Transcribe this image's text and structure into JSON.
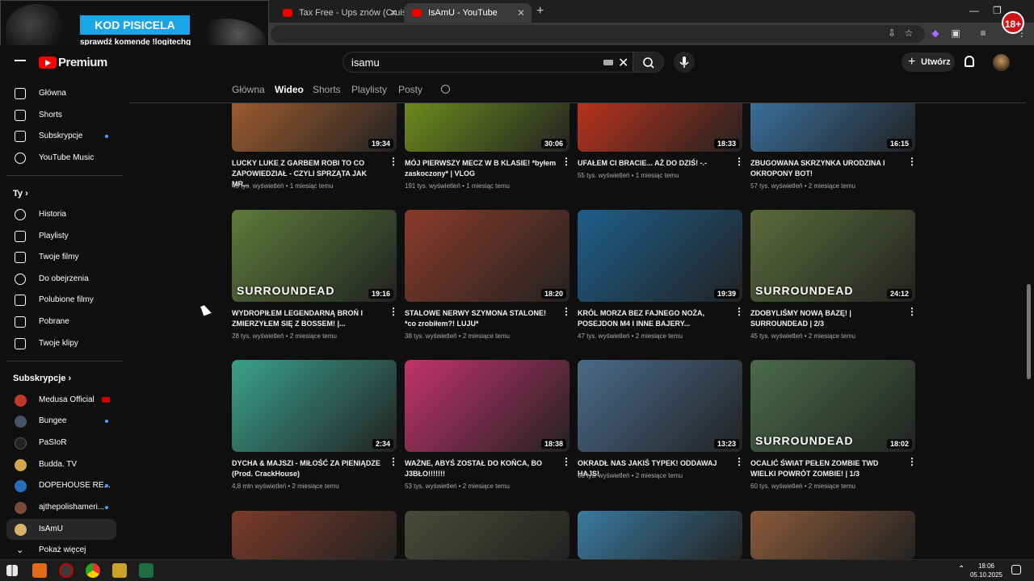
{
  "browser": {
    "tabs": [
      {
        "title": "Tax Free - Ups znów (Cruisy"
      },
      {
        "title": "IsAmU - YouTube"
      }
    ]
  },
  "overlay": {
    "headline": "KOD PISICELA",
    "subline": "sprawdź komendę !logitechg"
  },
  "badge": "18+",
  "header": {
    "logo_text": "Premium",
    "search_value": "isamu",
    "create_label": "Utwórz"
  },
  "channel_tabs": [
    "Główna",
    "Wideo",
    "Shorts",
    "Playlisty",
    "Posty"
  ],
  "sidebar": {
    "main": [
      {
        "label": "Główna",
        "icon": "home-icon"
      },
      {
        "label": "Shorts",
        "icon": "shorts-icon"
      },
      {
        "label": "Subskrypcje",
        "icon": "subscriptions-icon"
      },
      {
        "label": "YouTube Music",
        "icon": "music-icon"
      }
    ],
    "you_heading": "Ty",
    "you": [
      {
        "label": "Historia",
        "icon": "history-icon"
      },
      {
        "label": "Playlisty",
        "icon": "playlists-icon"
      },
      {
        "label": "Twoje filmy",
        "icon": "your-videos-icon"
      },
      {
        "label": "Do obejrzenia",
        "icon": "watch-later-icon"
      },
      {
        "label": "Polubione filmy",
        "icon": "liked-icon"
      },
      {
        "label": "Pobrane",
        "icon": "download-icon"
      },
      {
        "label": "Twoje klipy",
        "icon": "clips-icon"
      }
    ],
    "subs_heading": "Subskrypcje",
    "subs": [
      {
        "label": "Medusa Official",
        "color": "#c0392b"
      },
      {
        "label": "Bungee",
        "color": "#445566"
      },
      {
        "label": "PaSIoR",
        "color": "#222222"
      },
      {
        "label": "Budda. TV",
        "color": "#d4a64a"
      },
      {
        "label": "DOPEHOUSE RE...",
        "color": "#2a6ebb"
      },
      {
        "label": "ajthepolishameri...",
        "color": "#7a4a3a"
      },
      {
        "label": "IsAmU",
        "color": "#d8b26a"
      }
    ],
    "show_more": "Pokaż więcej"
  },
  "videos": [
    {
      "title": "LUCKY LUKE Z GARBEM ROBI TO CO ZAPOWIEDZIAŁ - CZYLI SPRZĄTA JAK MR...",
      "views": "49 tys. wyświetleń",
      "age": "1 miesiąc temu",
      "duration": "19:34",
      "bg": "#9b5a2f"
    },
    {
      "title": "MÓJ PIERWSZY MECZ W B KLASIE! *byłem zaskoczony* | VLOG",
      "views": "191 tys. wyświetleń",
      "age": "1 miesiąc temu",
      "duration": "30:06",
      "bg": "#6e8a1e"
    },
    {
      "title": "UFAŁEM CI BRACIE... AŻ DO DZIŚ! -.-",
      "views": "55 tys. wyświetleń",
      "age": "1 miesiąc temu",
      "duration": "18:33",
      "bg": "#b8321e"
    },
    {
      "title": "ZBUGOWANA SKRZYNKA URODZINA I OKROPONY BOT!",
      "views": "57 tys. wyświetleń",
      "age": "2 miesiące temu",
      "duration": "16:15",
      "bg": "#3a6e9a"
    },
    {
      "title": "WYDROPIŁEM LEGENDARNĄ BROŃ I ZMIERZYŁEM SIĘ Z BOSSEM! |...",
      "views": "28 tys. wyświetleń",
      "age": "2 miesiące temu",
      "duration": "19:16",
      "bg": "#5d7a3a",
      "label": "SURROUNDEAD"
    },
    {
      "title": "STALOWE NERWY SZYMONA STALONE! *co zrobiłem?! LUJU*",
      "views": "38 tys. wyświetleń",
      "age": "2 miesiące temu",
      "duration": "18:20",
      "bg": "#8a3a2a"
    },
    {
      "title": "KRÓL MORZA BEZ FAJNEGO NOŻA, POSEJDON M4 I INNE BAJERY...",
      "views": "47 tys. wyświetleń",
      "age": "2 miesiące temu",
      "duration": "19:39",
      "bg": "#1e5e8a"
    },
    {
      "title": "ZDOBYLIŚMY NOWĄ BAZĘ! | SURROUNDEAD | 2/3",
      "views": "45 tys. wyświetleń",
      "age": "2 miesiące temu",
      "duration": "24:12",
      "bg": "#5a6a3a",
      "label": "SURROUNDEAD"
    },
    {
      "title": "DYCHA & MAJSZI - MIŁOŚĆ ZA PIENIĄDZE (Prod. CrackHouse)",
      "views": "4,8 mln wyświetleń",
      "age": "2 miesiące temu",
      "duration": "2:34",
      "bg": "#3aa08a"
    },
    {
      "title": "WAŻNE, ABYŚ ZOSTAŁ DO KOŃCA, BO J3BŁO!!!!!!!",
      "views": "53 tys. wyświetleń",
      "age": "2 miesiące temu",
      "duration": "18:38",
      "bg": "#c2336a"
    },
    {
      "title": "OKRADŁ NAS JAKIŚ TYPEK! ODDAWAJ HAJS!",
      "views": "68 tys. wyświetleń",
      "age": "2 miesiące temu",
      "duration": "13:23",
      "bg": "#4a6a8a"
    },
    {
      "title": "OCALIĆ ŚWIAT PEŁEN ZOMBIE TWD WIELKI POWRÓT ZOMBIE! | 1/3",
      "views": "60 tys. wyświetleń",
      "age": "2 miesiące temu",
      "duration": "18:02",
      "bg": "#4a6a4a",
      "label": "SURROUNDEAD"
    },
    {
      "bg": "#7a3a2a"
    },
    {
      "bg": "#4a4a3a"
    },
    {
      "bg": "#3a7aa0"
    },
    {
      "bg": "#8a5a3a"
    }
  ],
  "taskbar": {
    "time": "18:06",
    "date": "05.10.2025"
  }
}
